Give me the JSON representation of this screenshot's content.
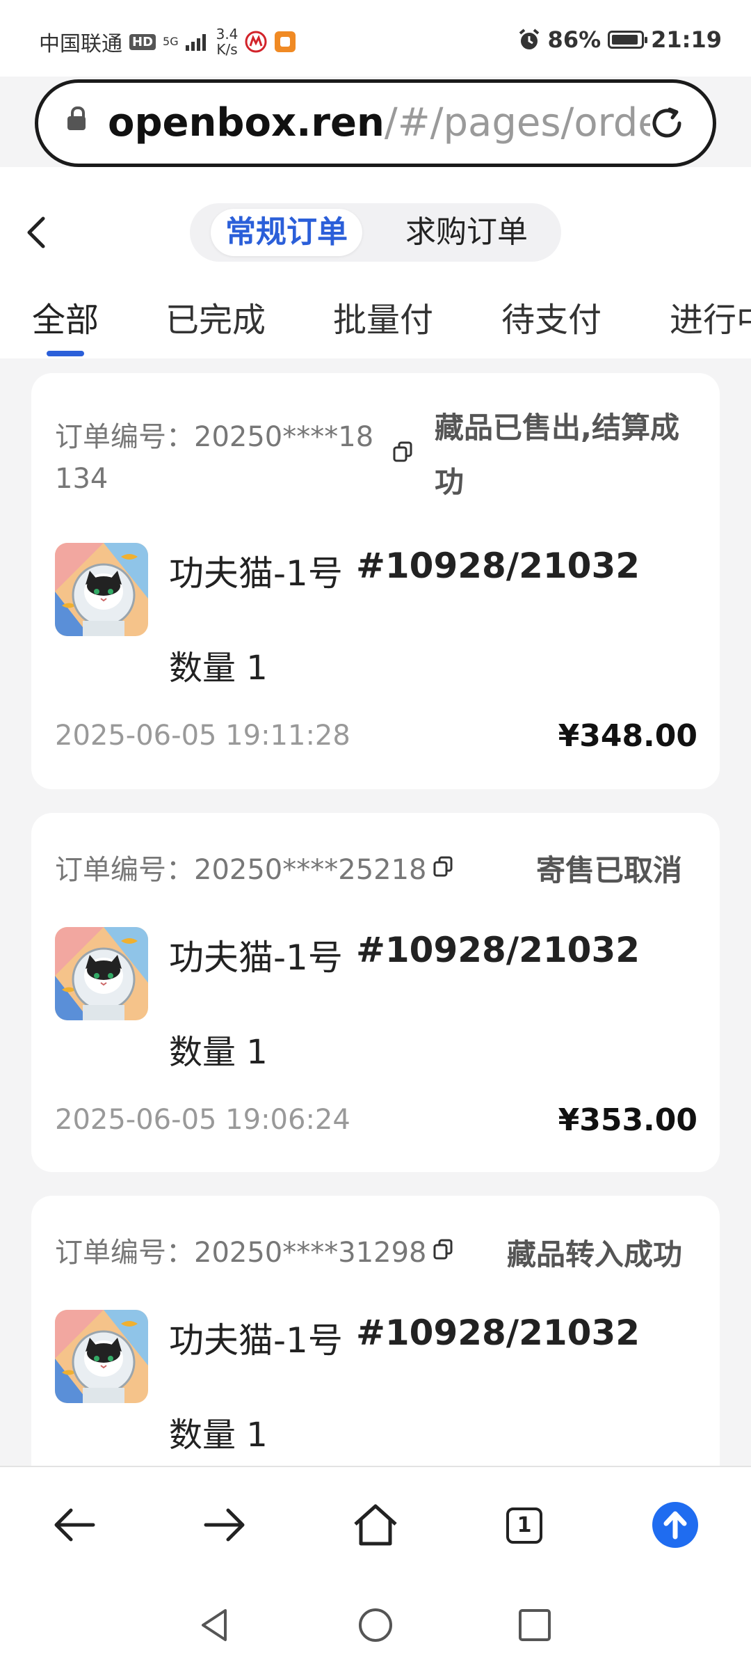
{
  "status_bar": {
    "carrier": "中国联通",
    "hd": "HD",
    "network": "5G",
    "speed_value": "3.4",
    "speed_unit": "K/s",
    "battery": "86%",
    "time": "21:19"
  },
  "url_bar": {
    "host": "openbox.ren",
    "path": "/#/pages/orde"
  },
  "header": {
    "segments": [
      "常规订单",
      "求购订单"
    ],
    "active_segment": "常规订单",
    "tabs": [
      "全部",
      "已完成",
      "批量付",
      "待支付",
      "进行中"
    ],
    "active_tab": "全部"
  },
  "orders": [
    {
      "order_label": "订单编号：",
      "order_no_line1": "20250****18",
      "order_no_line2": "134",
      "status_line1": "藏品已售出,结算成",
      "status_line2": "功",
      "product_name": "功夫猫-1号",
      "serial": "#10928/21032",
      "quantity": "数量 1",
      "time": "2025-06-05 19:11:28",
      "price": "¥348.00"
    },
    {
      "order_label": "订单编号：",
      "order_no": "20250****25218",
      "status": "寄售已取消",
      "product_name": "功夫猫-1号",
      "serial": "#10928/21032",
      "quantity": "数量 1",
      "time": "2025-06-05 19:06:24",
      "price": "¥353.00"
    },
    {
      "order_label": "订单编号：",
      "order_no": "20250****31298",
      "status": "藏品转入成功",
      "product_name": "功夫猫-1号",
      "serial": "#10928/21032",
      "quantity": "数量 1"
    }
  ],
  "toolbar": {
    "tab_count": "1",
    "icons": [
      "back-arrow-icon",
      "forward-arrow-icon",
      "home-icon",
      "tabs-icon",
      "upload-icon"
    ]
  },
  "nav_bar": {
    "icons": [
      "nav-back-icon",
      "nav-home-icon",
      "nav-recents-icon"
    ]
  },
  "colors": {
    "accent": "#2b5fd9",
    "upload": "#1f6cf0",
    "background": "#f4f4f5"
  }
}
